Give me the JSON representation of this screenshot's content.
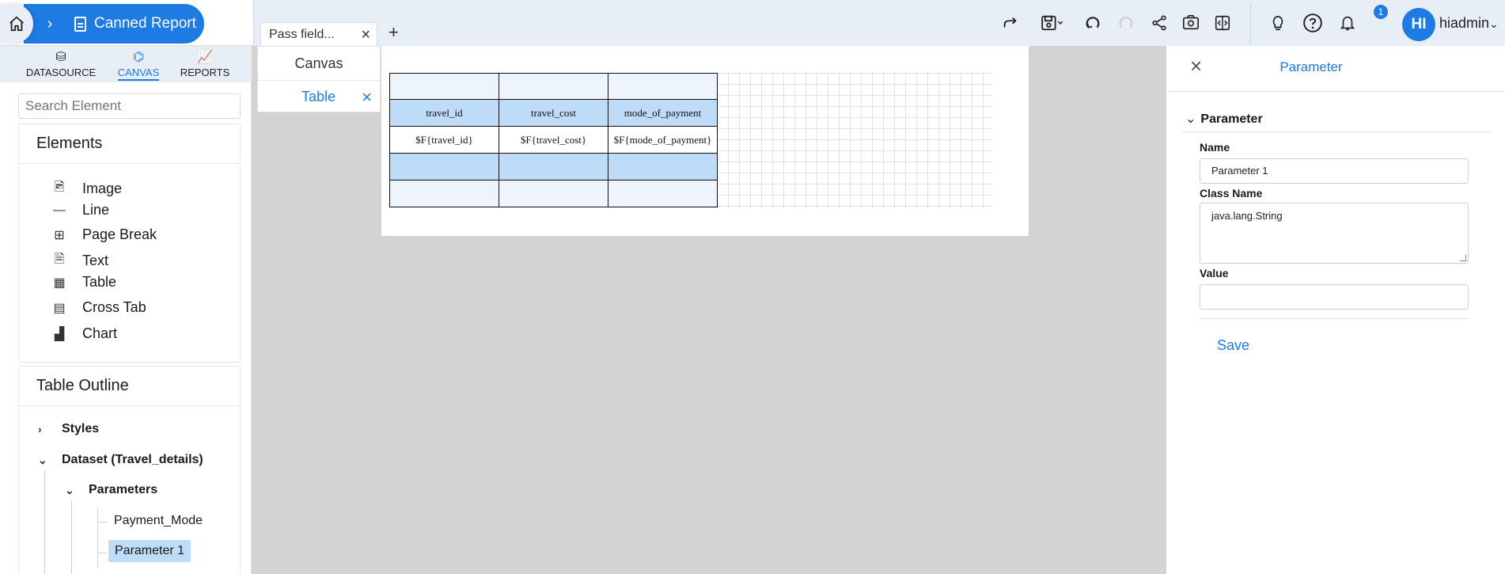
{
  "breadcrumb": {
    "report_label": "Canned Report"
  },
  "doc_tabs": {
    "active_tab": "Pass field...",
    "add_label": "+"
  },
  "user": {
    "initials": "HI",
    "name": "hiadmin",
    "notification_count": "1"
  },
  "left_tabs": [
    {
      "label": "DATASOURCE"
    },
    {
      "label": "CANVAS"
    },
    {
      "label": "REPORTS"
    }
  ],
  "search": {
    "placeholder": "Search Element"
  },
  "elements": {
    "title": "Elements",
    "items": [
      "Image",
      "Line",
      "Page Break",
      "Text",
      "Table",
      "Cross Tab",
      "Chart"
    ]
  },
  "outline": {
    "title": "Table Outline",
    "styles": "Styles",
    "dataset": "Dataset (Travel_details)",
    "parameters": "Parameters",
    "params": [
      "Payment_Mode",
      "Parameter 1"
    ]
  },
  "midnav": {
    "canvas": "Canvas",
    "table": "Table"
  },
  "report_table": {
    "headers": [
      "travel_id",
      "travel_cost",
      "mode_of_payment"
    ],
    "details": [
      "$F{travel_id}",
      "$F{travel_cost}",
      "$F{mode_of_payment}"
    ]
  },
  "parameter_panel": {
    "title": "Parameter",
    "section": "Parameter",
    "name_label": "Name",
    "name_value": "Parameter 1",
    "class_label": "Class Name",
    "class_value": "java.lang.String",
    "value_label": "Value",
    "value_value": "",
    "save_label": "Save"
  },
  "colors": {
    "accent": "#1e7be4",
    "header_fill": "#bedcf8",
    "selection": "#bcdcf8"
  }
}
